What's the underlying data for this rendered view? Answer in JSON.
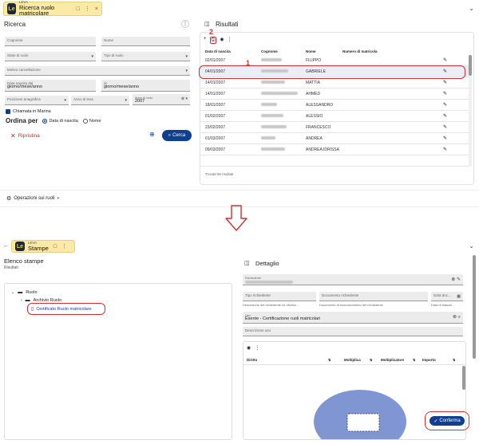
{
  "top_window": {
    "app_name": "LEVA",
    "title": "Ricerca ruolo matricolare",
    "tab_actions": [
      "□",
      "⋮",
      "×"
    ],
    "collapse_icon": "chevron-down",
    "search_panel": {
      "title": "Ricerca",
      "fields": {
        "cognome": "Cognome",
        "nome": "Nome",
        "stato_ruolo": "Stato di ruolo",
        "tipo_ruolo": "Tipo di ruolo",
        "motivo": "Motivo cancellazione",
        "data_nascita_da_label": "Data nascita dal",
        "data_nascita_da_value": "giorno/mese/anno",
        "al_label": "al",
        "al_value": "giorno/mese/anno",
        "posizione": "Posizione anagrafica",
        "anno_leva": "Anno di leva",
        "anno_ruolo_label": "Anno di ruolo",
        "anno_ruolo_value": "2007"
      },
      "checkbox_marina": "Chiamata in Marina",
      "order_by_label": "Ordina per",
      "order_options": [
        "Data di nascita",
        "Nome"
      ],
      "reset_label": "Ripristina",
      "search_label": "Cerca"
    },
    "results_panel": {
      "title": "Risultati",
      "columns": [
        "Data di nascita",
        "Cognome",
        "Nome",
        "Numero di matricola"
      ],
      "rows": [
        {
          "date": "02/01/2007",
          "name": "FILIPPO"
        },
        {
          "date": "04/01/2007",
          "name": "GABRIELE"
        },
        {
          "date": "14/01/2007",
          "name": "MATTIA"
        },
        {
          "date": "14/01/2007",
          "name": "AHMED"
        },
        {
          "date": "18/01/2007",
          "name": "ALESSANDRO"
        },
        {
          "date": "01/02/2007",
          "name": "ALESSIO"
        },
        {
          "date": "23/02/2007",
          "name": "FRANCESCO"
        },
        {
          "date": "01/03/2007",
          "name": "ANDREA"
        },
        {
          "date": "09/03/2007",
          "name": "ANDREA IDRISSA"
        }
      ],
      "footer": "Trovati 66 risultati"
    },
    "operations_label": "Operazioni sui ruoli",
    "annotations": {
      "marker_1": "1",
      "marker_2": "2"
    }
  },
  "bottom_window": {
    "app_name": "LEVA",
    "title": "Stampe",
    "list_panel": {
      "title": "Elenco stampe",
      "subtitle": "Risultati",
      "tree": {
        "root": "Ruolo",
        "child": "Archivio Ruolo",
        "leaf": "Certificato Ruolo matricolare"
      }
    },
    "detail_panel": {
      "title": "Dettaglio",
      "richiedente_label": "Richiedente",
      "tipo_richiedente": "Tipo richiedente",
      "tipo_richiedente_help": "Descrizione del richiedente se diverso ...",
      "documento": "Documento richiedente",
      "documento_help": "Documento di riconoscimento del richiedente",
      "data_doc": "Data doc...",
      "data_doc_help": "Data di rilascio ...",
      "uso_label": "Uso",
      "uso_value": "Esente - Certificazione ruoli matricolari",
      "descrizione_uso": "Descrizione uso",
      "grid_columns": [
        "Diritto",
        "Moltiplica",
        "Moltiplicatore",
        "Importo"
      ],
      "confirm_label": "Conferma"
    }
  },
  "colors": {
    "accent": "#0f3f8f",
    "highlight": "#d32f2f",
    "tab_bg": "#fbe9a6"
  }
}
